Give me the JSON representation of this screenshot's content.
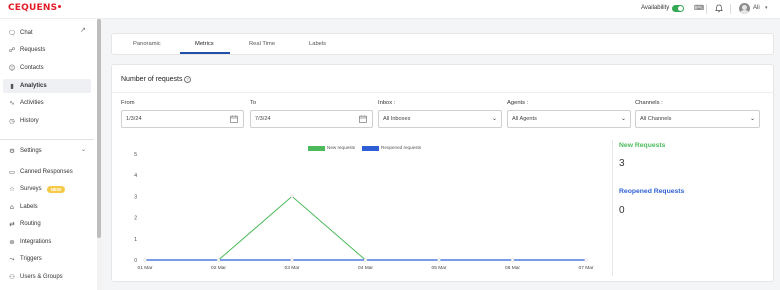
{
  "app": {
    "logo": "CEQUENS",
    "availability_label": "Availability",
    "user_name": "Ali"
  },
  "sidebar": {
    "items": [
      {
        "label": "Chat",
        "icon": "chat-icon"
      },
      {
        "label": "Requests",
        "icon": "requests-icon"
      },
      {
        "label": "Contacts",
        "icon": "contacts-icon"
      },
      {
        "label": "Analytics",
        "icon": "analytics-icon",
        "active": true
      },
      {
        "label": "Activities",
        "icon": "activities-icon"
      },
      {
        "label": "History",
        "icon": "history-icon"
      },
      {
        "label": "Settings",
        "icon": "settings-icon"
      },
      {
        "label": "Canned Responses",
        "icon": "canned-responses-icon"
      },
      {
        "label": "Surveys",
        "icon": "surveys-icon",
        "badge": "NEW"
      },
      {
        "label": "Labels",
        "icon": "labels-icon"
      },
      {
        "label": "Routing",
        "icon": "routing-icon"
      },
      {
        "label": "Integrations",
        "icon": "integrations-icon"
      },
      {
        "label": "Triggers",
        "icon": "triggers-icon"
      },
      {
        "label": "Users & Groups",
        "icon": "users-groups-icon"
      }
    ]
  },
  "tabs": [
    "Panoramic",
    "Metrics",
    "Real Time",
    "Labels"
  ],
  "active_tab": "Metrics",
  "panel": {
    "title": "Number of requests",
    "filters": {
      "from_label": "From",
      "from_value": "1/3/24",
      "to_label": "To",
      "to_value": "7/3/24",
      "inbox_label": "Inbox :",
      "inbox_value": "All Inboxes",
      "agents_label": "Agents :",
      "agents_value": "All Agents",
      "channels_label": "Channels :",
      "channels_value": "All Channels"
    }
  },
  "stats": {
    "new_label": "New Requests",
    "new_value": "3",
    "reopened_label": "Reopened Requests",
    "reopened_value": "0"
  },
  "colors": {
    "new": "#4cba5a",
    "reopened": "#2f5fd6",
    "accent": "#1f4fa8",
    "brand": "#e51c2a"
  },
  "chart_data": {
    "type": "line",
    "categories": [
      "01 Mar",
      "02 Mar",
      "03 Mar",
      "04 Mar",
      "05 Mar",
      "06 Mar",
      "07 Mar"
    ],
    "series": [
      {
        "name": "New requests",
        "values": [
          0,
          0,
          3,
          0,
          0,
          0,
          0
        ],
        "color": "#4cba5a"
      },
      {
        "name": "Reopened requests",
        "values": [
          0,
          0,
          0,
          0,
          0,
          0,
          0
        ],
        "color": "#2f5fd6"
      }
    ],
    "y_ticks": [
      0,
      1,
      2,
      3,
      4,
      5
    ],
    "ylim": [
      0,
      5
    ],
    "legend": "top-center",
    "grid": false
  }
}
